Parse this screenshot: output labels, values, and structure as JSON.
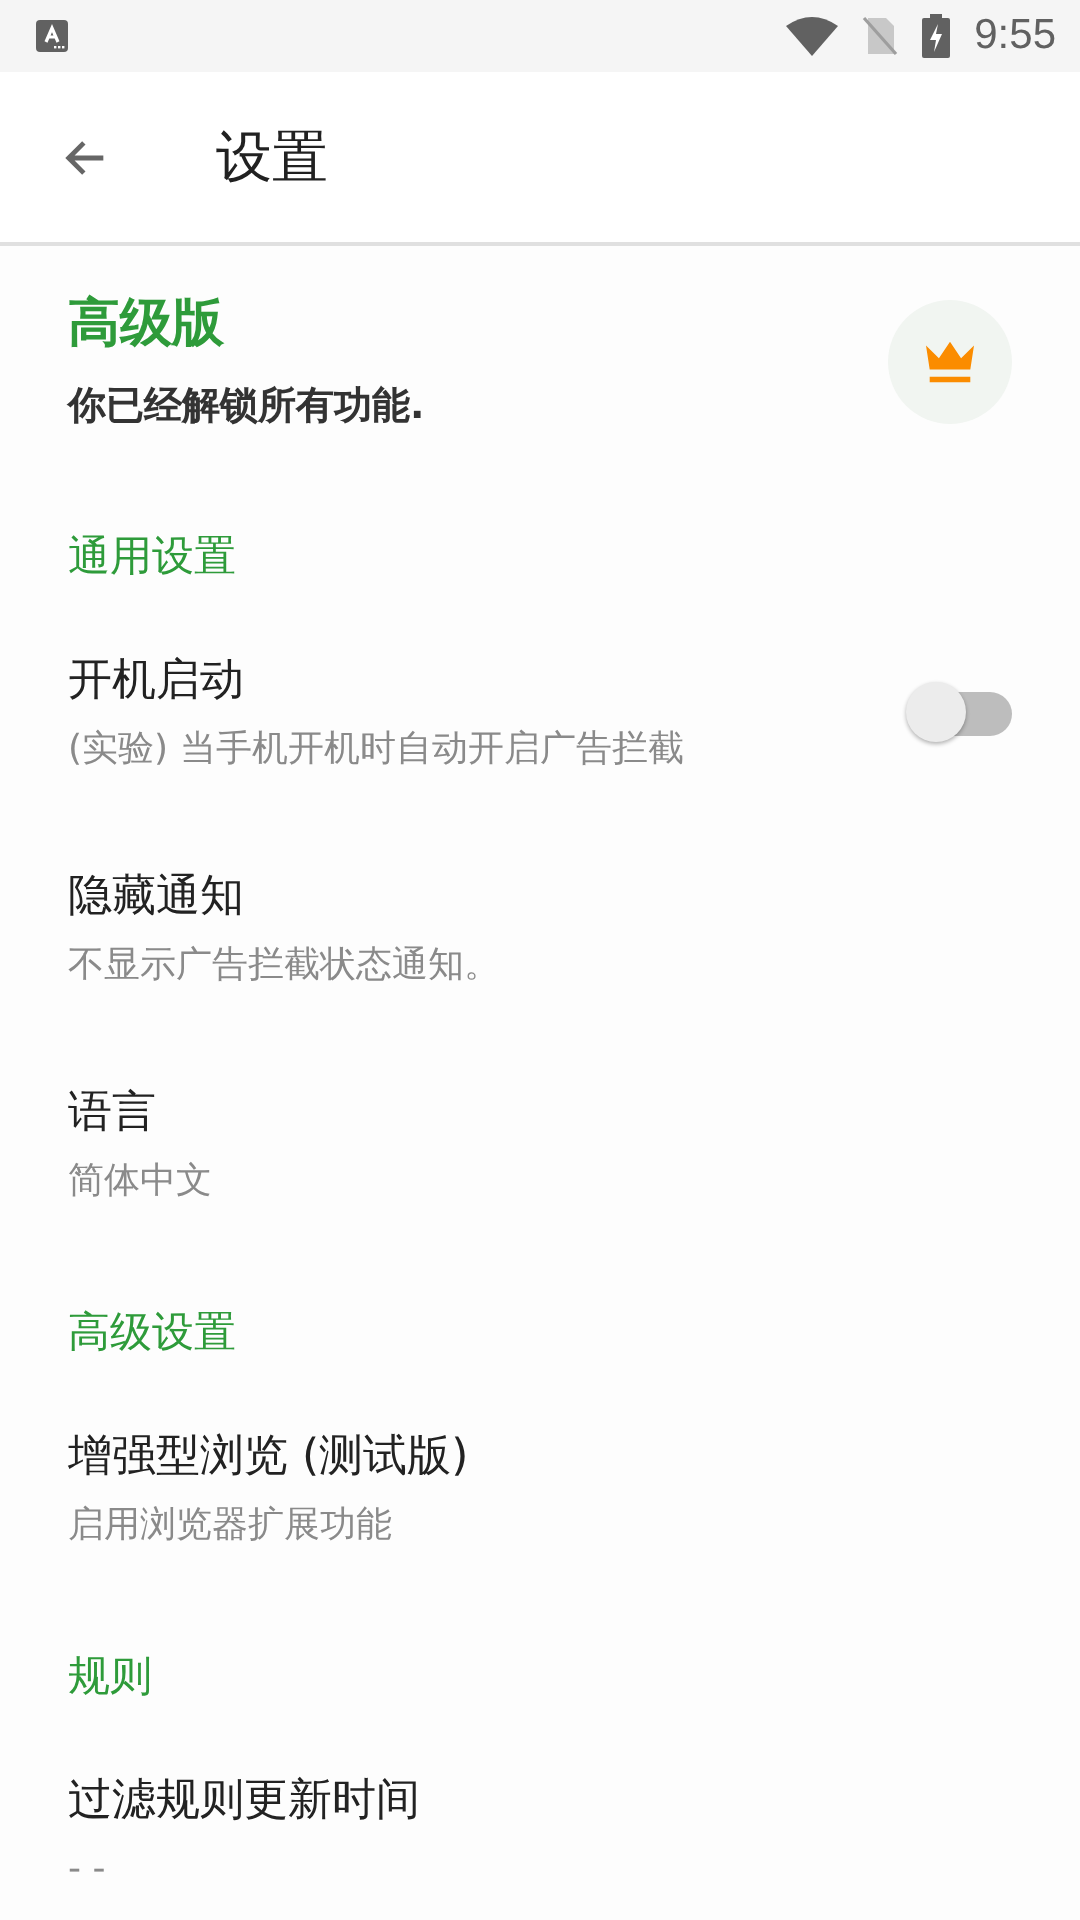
{
  "status_bar": {
    "time": "9:55"
  },
  "app_bar": {
    "title": "设置"
  },
  "premium": {
    "title": "高级版",
    "subtitle": "你已经解锁所有功能."
  },
  "sections": [
    {
      "title": "通用设置",
      "items": [
        {
          "kind": "switch",
          "title": "开机启动",
          "subtitle": "(实验) 当手机开机时自动开启广告拦截",
          "on": false
        },
        {
          "kind": "plain",
          "title": "隐藏通知",
          "subtitle": "不显示广告拦截状态通知。"
        },
        {
          "kind": "plain",
          "title": "语言",
          "subtitle": "简体中文"
        }
      ]
    },
    {
      "title": "高级设置",
      "items": [
        {
          "kind": "plain",
          "title": "增强型浏览 (测试版)",
          "subtitle": "启用浏览器扩展功能"
        }
      ]
    },
    {
      "title": "规则",
      "items": [
        {
          "kind": "plain",
          "title": "过滤规则更新时间",
          "subtitle": "- -"
        }
      ]
    }
  ]
}
